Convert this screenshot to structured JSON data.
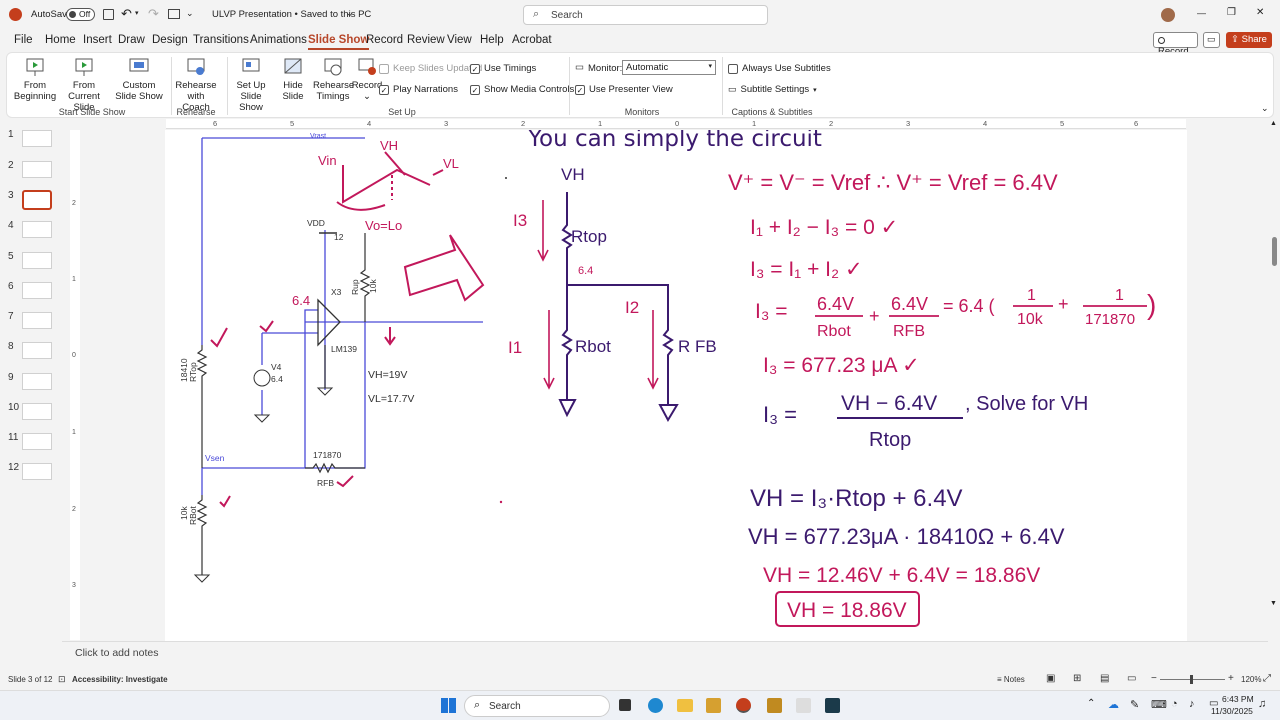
{
  "app": {
    "autosave_label": "AutoSave",
    "autosave_state": "Off",
    "doc_title": "ULVP Presentation • Saved to this PC",
    "search_placeholder": "Search"
  },
  "window": {
    "minimize": "—",
    "maximize": "❐",
    "close": "✕"
  },
  "menu": [
    "File",
    "Home",
    "Insert",
    "Draw",
    "Design",
    "Transitions",
    "Animations",
    "Slide Show",
    "Record",
    "Review",
    "View",
    "Help",
    "Acrobat"
  ],
  "menu_active": "Slide Show",
  "topright": {
    "record": "Record",
    "share": "Share"
  },
  "ribbon": {
    "from_beginning": "From Beginning",
    "from_current": "From Current Slide",
    "custom_show": "Custom Slide Show",
    "group_start": "Start Slide Show",
    "rehearse_coach": "Rehearse with Coach",
    "group_rehearse": "Rehearse",
    "setup_show": "Set Up Slide Show",
    "hide_slide": "Hide Slide",
    "rehearse_timings": "Rehearse Timings",
    "record": "Record",
    "keep_updated": "Keep Slides Updated",
    "use_timings": "Use Timings",
    "play_narrations": "Play Narrations",
    "show_media": "Show Media Controls",
    "group_setup": "Set Up",
    "monitor_label": "Monitor:",
    "monitor_value": "Automatic",
    "presenter_view": "Use Presenter View",
    "group_monitors": "Monitors",
    "always_subtitles": "Always Use Subtitles",
    "subtitle_settings": "Subtitle Settings",
    "group_captions": "Captions & Subtitles"
  },
  "thumbs": [
    "1",
    "2",
    "3",
    "4",
    "5",
    "6",
    "7",
    "8",
    "9",
    "10",
    "11",
    "12"
  ],
  "ruler_top": [
    "6",
    "5",
    "4",
    "3",
    "2",
    "1",
    "0",
    "1",
    "2",
    "3",
    "4",
    "5",
    "6"
  ],
  "ruler_left": [
    "2",
    "1",
    "0",
    "1",
    "2",
    "3"
  ],
  "circuit": {
    "vdd": "VDD",
    "vdd_val": "12",
    "x3": "X3",
    "lm": "LM139",
    "rup": "Rup",
    "rup_val": "10k",
    "v4": "V4",
    "v4_val": "6.4",
    "rtop": "RTop",
    "rtop_val": "18410",
    "vsen": "Vsen",
    "rfb_val": "171870",
    "rfb": "RFB",
    "rbot": "RBot",
    "rbot_val": "10k",
    "vh_note": "VH=19V",
    "vl_note": "VL=17.7V",
    "vrast": "Vrast"
  },
  "handwriting": {
    "header": "You can simply the circuit",
    "vin": "Vin",
    "vh": "VH",
    "vl": "VL",
    "vo": "Vo=Lo",
    "v641": "6.4",
    "vh_node": "VH",
    "i3": "I3",
    "rtop": "Rtop",
    "vout": "6.4",
    "i1": "I1",
    "rbot": "Rbot",
    "i2": "I2",
    "rfb": "R FB",
    "eq1": "V⁺ = V⁻ = Vref  ∴  V⁺ = Vref = 6.4V",
    "eq2": "I₁ + I₂ − I₃ = 0 ✓",
    "eq3": "I₃ = I₁ + I₂ ✓",
    "eq4a": "I₃ =",
    "eq4b": "6.4V",
    "eq4c": "Rbot",
    "eq4d": "+",
    "eq4e": "6.4V",
    "eq4f": "RFB",
    "eq4g": "= 6.4 (",
    "eq4h": "1",
    "eq4i": "10k",
    "eq4j": "+",
    "eq4k": "1",
    "eq4l": "171870",
    ")": ")",
    "eq5": "I₃ = 677.23 μA ✓",
    "eq6a": "I₃ =",
    "eq6b": "VH − 6.4V",
    "eq6c": "Rtop",
    "eq6d": ", Solve for VH",
    "eq7": "VH = I₃·Rtop + 6.4V",
    "eq8": "VH = 677.23μA · 18410Ω + 6.4V",
    "eq9": "VH = 12.46V + 6.4V = 18.86V",
    "eq10": "VH = 18.86V"
  },
  "notes_placeholder": "Click to add notes",
  "status": {
    "slide": "Slide 3 of 12",
    "accessibility": "Accessibility: Investigate",
    "notes": "Notes",
    "zoom": "120%"
  },
  "taskbar": {
    "search": "Search",
    "time": "6:43 PM",
    "date": "11/30/2025"
  },
  "colors": {
    "accent": "#b7472a",
    "ink_magenta": "#c2185b",
    "ink_purple": "#3b1a6e",
    "ink_blue": "#2a2aa8"
  }
}
